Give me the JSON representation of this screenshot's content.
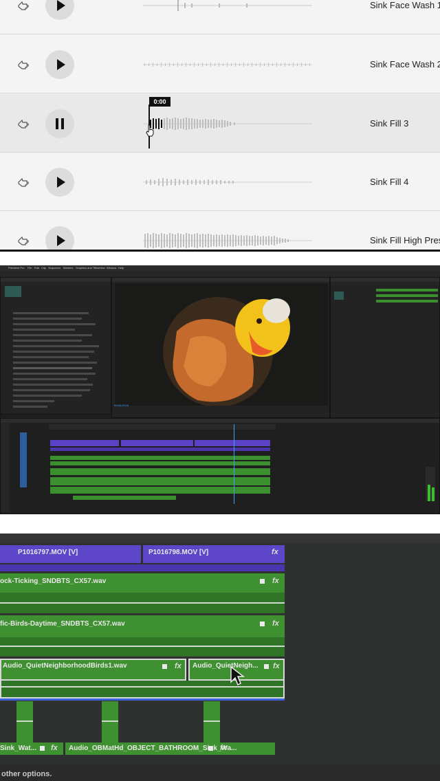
{
  "sounds": [
    {
      "name": "Sink Face Wash 1",
      "state": "play"
    },
    {
      "name": "Sink Face Wash 2",
      "state": "play"
    },
    {
      "name": "Sink Fill 3",
      "state": "pause"
    },
    {
      "name": "Sink Fill 4",
      "state": "play"
    },
    {
      "name": "Sink Fill High Press",
      "state": "play"
    }
  ],
  "player": {
    "time": "0:00"
  },
  "premiere": {
    "menubar": [
      "Premiere Pro",
      "File",
      "Edit",
      "Clip",
      "Sequence",
      "Markers",
      "Graphics and Titles",
      "View",
      "Window",
      "Help"
    ],
    "timecode": "00;00;28;04"
  },
  "zoomed_timeline": {
    "video_clips": [
      "P1016797.MOV [V]",
      "P1016798.MOV [V]"
    ],
    "audio_clips": [
      "ock-Ticking_SNDBTS_CX57.wav",
      "fic-Birds-Daytime_SNDBTS_CX57.wav",
      "Audio_QuietNeighborhoodBirds1.wav",
      "Audio_QuietNeigh...",
      "Sink_Wat...",
      "Audio_OBMatHd_OBJECT_BATHROOM_Sink_Wa..."
    ],
    "fx_label": "fx",
    "hint": "other options."
  },
  "colors": {
    "video_clip": "#5d47c8",
    "audio_clip": "#3e9030",
    "timecode": "#3fa0ff"
  }
}
